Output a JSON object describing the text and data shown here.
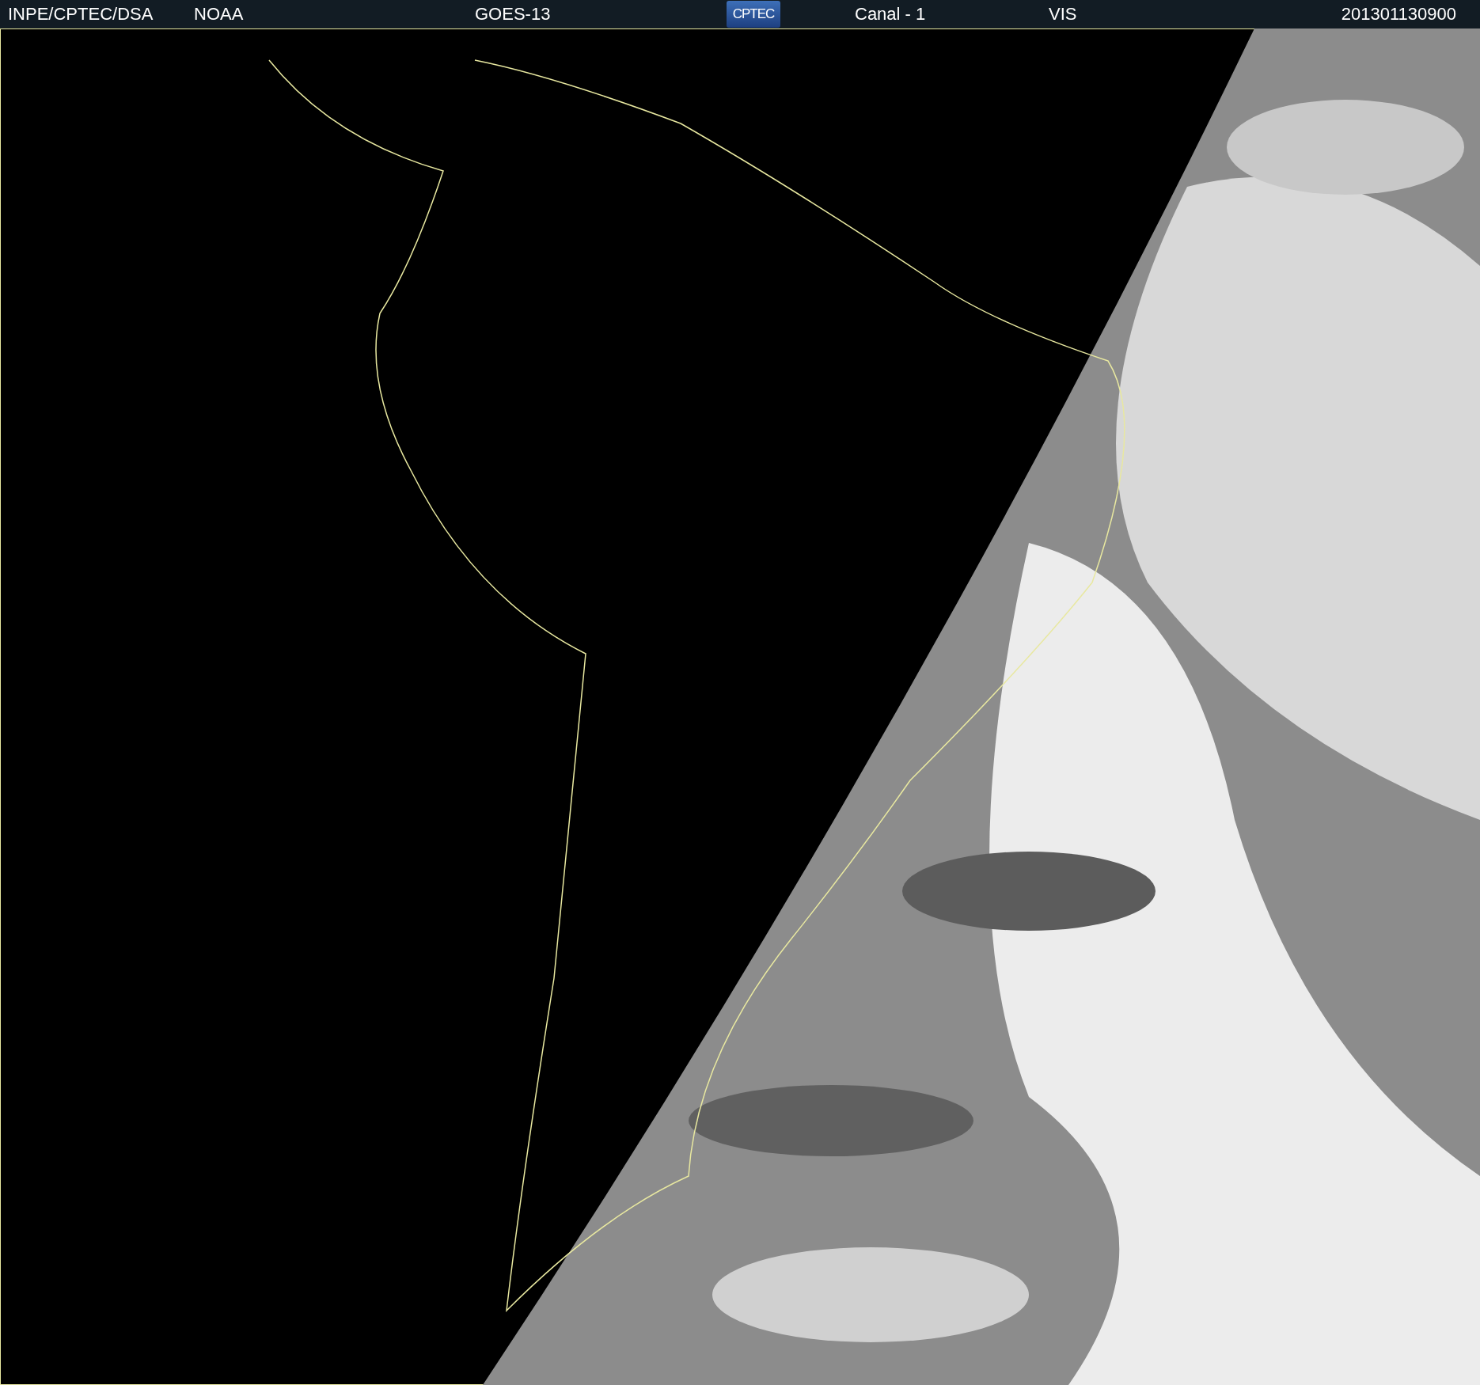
{
  "header": [
    {
      "kind": "text",
      "text": "INPE/CPTEC/DSA"
    },
    {
      "kind": "text",
      "text": "NOAA"
    },
    {
      "kind": "text",
      "text": "GOES-13"
    },
    {
      "kind": "logo",
      "text": "CPTEC"
    },
    {
      "kind": "text",
      "text": "Canal - 1"
    },
    {
      "kind": "text",
      "text": "VIS"
    },
    {
      "kind": "text",
      "text": "201301130900"
    }
  ]
}
